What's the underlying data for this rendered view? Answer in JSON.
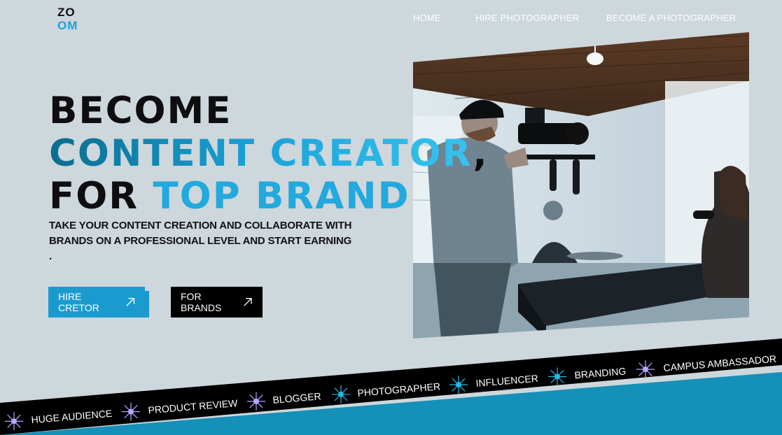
{
  "logo": {
    "line1": "ZO",
    "line2": "OM"
  },
  "nav": {
    "home": "HOME",
    "hire": "HIRE PHOTOGRAPHER",
    "become": "BECOME A PHOTOGRAPHER"
  },
  "hero": {
    "line1": "BECOME",
    "line2": "CONTENT CREATOR",
    "comma": ",",
    "line3a": "FOR",
    "line3b": "TOP BRAND",
    "subtext": "TAKE YOUR CONTENT CREATION AND COLLABORATE WITH BRANDS  ON A PROFESSIONAL LEVEL  AND START EARNING ."
  },
  "buttons": {
    "hire_creator": "HIRE CRETOR",
    "for_brands": "FOR  BRANDS"
  },
  "ticker": {
    "items": [
      "HUGE AUDIENCE",
      "PRODUCT REVIEW",
      "BLOGGER",
      "PHOTOGRAPHER",
      "INFLUENCER",
      "BRANDING",
      "CAMPUS AMBASSADOR"
    ]
  },
  "colors": {
    "background": "#cdd7dc",
    "accent": "#1ba3d8",
    "ticker_band": "#000000",
    "ticker_bottom": "#1590b8"
  }
}
